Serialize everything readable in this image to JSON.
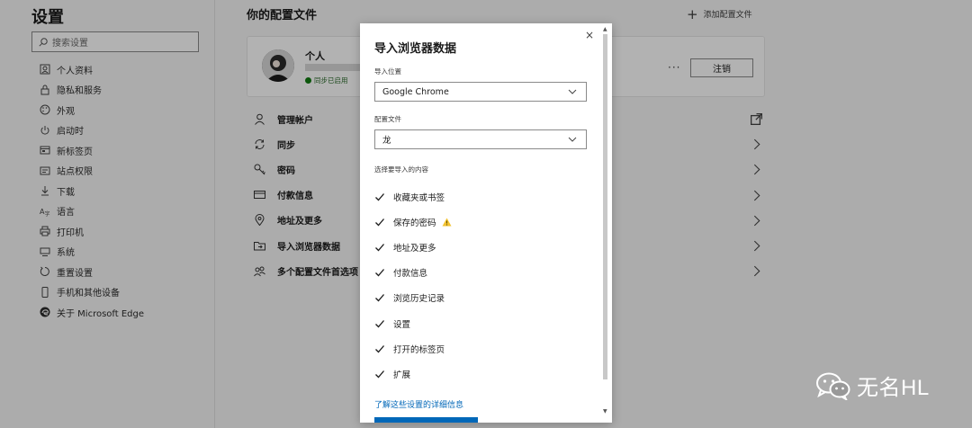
{
  "sidebar": {
    "title": "设置",
    "search_placeholder": "搜索设置",
    "items": [
      {
        "label": "个人资料",
        "icon": "profile-icon"
      },
      {
        "label": "隐私和服务",
        "icon": "lock-icon"
      },
      {
        "label": "外观",
        "icon": "palette-icon"
      },
      {
        "label": "启动时",
        "icon": "power-icon"
      },
      {
        "label": "新标签页",
        "icon": "newtab-icon"
      },
      {
        "label": "站点权限",
        "icon": "permissions-icon"
      },
      {
        "label": "下载",
        "icon": "download-icon"
      },
      {
        "label": "语言",
        "icon": "language-icon"
      },
      {
        "label": "打印机",
        "icon": "printer-icon"
      },
      {
        "label": "系统",
        "icon": "system-icon"
      },
      {
        "label": "重置设置",
        "icon": "reset-icon"
      },
      {
        "label": "手机和其他设备",
        "icon": "phone-icon"
      },
      {
        "label": "关于 Microsoft Edge",
        "icon": "edge-icon"
      }
    ]
  },
  "main": {
    "header": "你的配置文件",
    "add_profile": "添加配置文件",
    "profile": {
      "name": "个人",
      "sync_status": "同步已启用",
      "more": "···",
      "logout": "注销"
    },
    "settings": [
      {
        "label": "管理帐户",
        "icon": "person-icon",
        "trailing": "external-link-icon"
      },
      {
        "label": "同步",
        "icon": "sync-icon",
        "trailing": "chevron-right-icon"
      },
      {
        "label": "密码",
        "icon": "key-icon",
        "trailing": "chevron-right-icon"
      },
      {
        "label": "付款信息",
        "icon": "card-icon",
        "trailing": "chevron-right-icon"
      },
      {
        "label": "地址及更多",
        "icon": "location-icon",
        "trailing": "chevron-right-icon"
      },
      {
        "label": "导入浏览器数据",
        "icon": "folder-import-icon",
        "trailing": "chevron-right-icon"
      },
      {
        "label": "多个配置文件首选项",
        "icon": "profiles-icon",
        "trailing": "chevron-right-icon"
      }
    ]
  },
  "dialog": {
    "title": "导入浏览器数据",
    "close": "×",
    "import_from_label": "导入位置",
    "import_from_value": "Google Chrome",
    "profile_label": "配置文件",
    "profile_value": "龙",
    "choose_label": "选择要导入的内容",
    "items": [
      {
        "label": "收藏夹或书签",
        "checked": true,
        "warning": false
      },
      {
        "label": "保存的密码",
        "checked": true,
        "warning": true
      },
      {
        "label": "地址及更多",
        "checked": true,
        "warning": false
      },
      {
        "label": "付款信息",
        "checked": true,
        "warning": false
      },
      {
        "label": "浏览历史记录",
        "checked": true,
        "warning": false
      },
      {
        "label": "设置",
        "checked": true,
        "warning": false
      },
      {
        "label": "打开的标签页",
        "checked": true,
        "warning": false
      },
      {
        "label": "扩展",
        "checked": true,
        "warning": false
      }
    ],
    "learn_more": "了解这些设置的详细信息"
  },
  "watermark": {
    "text": "无名HL"
  },
  "colors": {
    "accent": "#0067b8",
    "warning": "#f2c230",
    "sync": "#107c10"
  }
}
